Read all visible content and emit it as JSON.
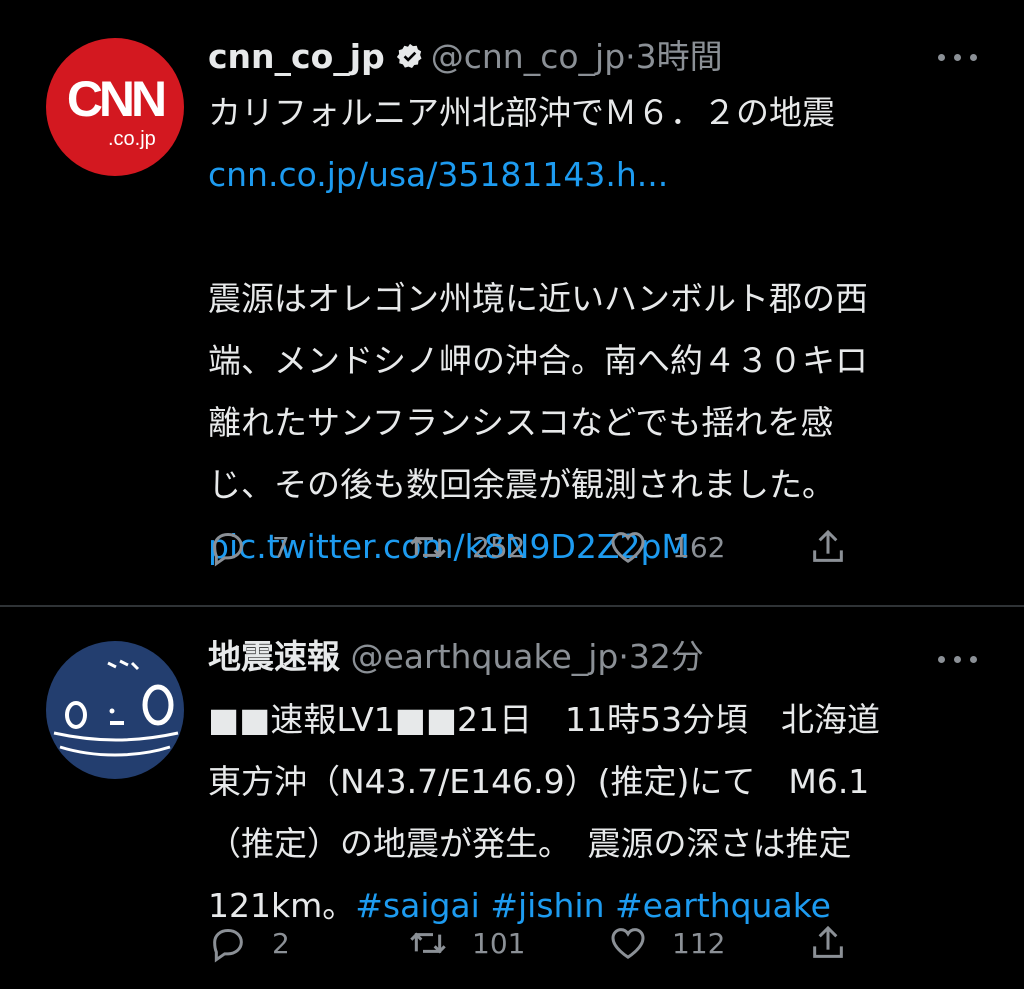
{
  "tweets": [
    {
      "author": {
        "name": "cnn_co_jp",
        "handle": "@cnn_co_jp",
        "avatar_text": "CNN",
        "avatar_sub": ".co.jp",
        "avatar_color": "#d31820"
      },
      "time": "3時間",
      "lines": [
        "カリフォルニア州北部沖でＭ６．２の地震",
        "cnn.co.jp/usa/35181143.h...",
        "",
        "震源はオレゴン州境に近いハンボルト郡の西",
        "端、メンドシノ岬の沖合。南へ約４３０キロ",
        "離れたサンフランシスコなどでも揺れを感",
        "じ、その後も数回余震が観測されました。",
        "pic.twitter.com/k8N9D2Z2pM"
      ],
      "counts": {
        "reply": "7",
        "retweet": "252",
        "like": "162"
      }
    },
    {
      "author": {
        "name": "地震速報",
        "handle": "@earthquake_jp",
        "avatar_color": "#233e6f"
      },
      "time": "32分",
      "lines": [
        "■■速報LV1■■21日　11時53分頃　北海道",
        "東方沖（N43.7/E146.9）(推定)にて　M6.1",
        "（推定）の地震が発生。　震源の深さは推定",
        "121km。"
      ],
      "hashtags": [
        "#saigai",
        "#jishin",
        "#earthquake"
      ],
      "counts": {
        "reply": "2",
        "retweet": "101",
        "like": "112"
      }
    }
  ],
  "ui": {
    "separator": "·",
    "icons": [
      "verified-badge-icon",
      "more-options-icon",
      "reply-icon",
      "retweet-icon",
      "like-icon",
      "share-icon"
    ],
    "colors": {
      "background": "#000000",
      "text": "#e7e9ea",
      "muted": "#8b9096",
      "link": "#1d9bf0",
      "divider": "#2f3336"
    }
  }
}
